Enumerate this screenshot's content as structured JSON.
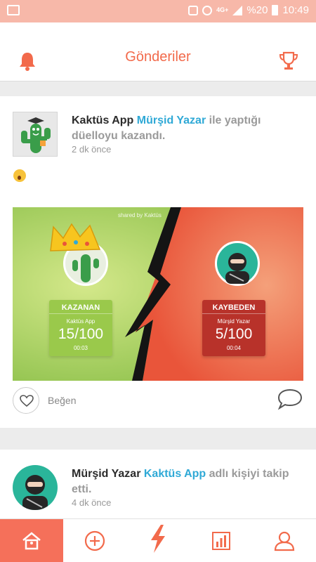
{
  "status_bar": {
    "network": "4G+",
    "battery": "%20",
    "time": "10:49"
  },
  "header": {
    "title": "Gönderiler",
    "left_icon": "bell-icon",
    "right_icon": "trophy-icon"
  },
  "post1": {
    "name": "Kaktüs App",
    "opponent": "Mürşid Yazar",
    "text_rest": " ile yaptığı düelloyu kazandı.",
    "time": "2 dk önce",
    "duel": {
      "shared_by": "shared by Kaktüs",
      "winner": {
        "label": "KAZANAN",
        "name": "Kaktüs App",
        "score": "15/100",
        "duration": "00:03"
      },
      "loser": {
        "label": "KAYBEDEN",
        "name": "Mürşid Yazar",
        "score": "5/100",
        "duration": "00:04"
      }
    },
    "like_label": "Beğen"
  },
  "post2": {
    "name": "Mürşid Yazar",
    "target": "Kaktüs App",
    "text_rest": " adlı kişiyi takip etti.",
    "time": "4 dk önce"
  },
  "colors": {
    "accent": "#f26a4b",
    "link": "#2fa9d6",
    "win": "#9ac94b",
    "lose": "#b8322a"
  },
  "bottom_nav": [
    "home-icon",
    "add-circle-icon",
    "lightning-icon",
    "stats-icon",
    "profile-icon"
  ]
}
